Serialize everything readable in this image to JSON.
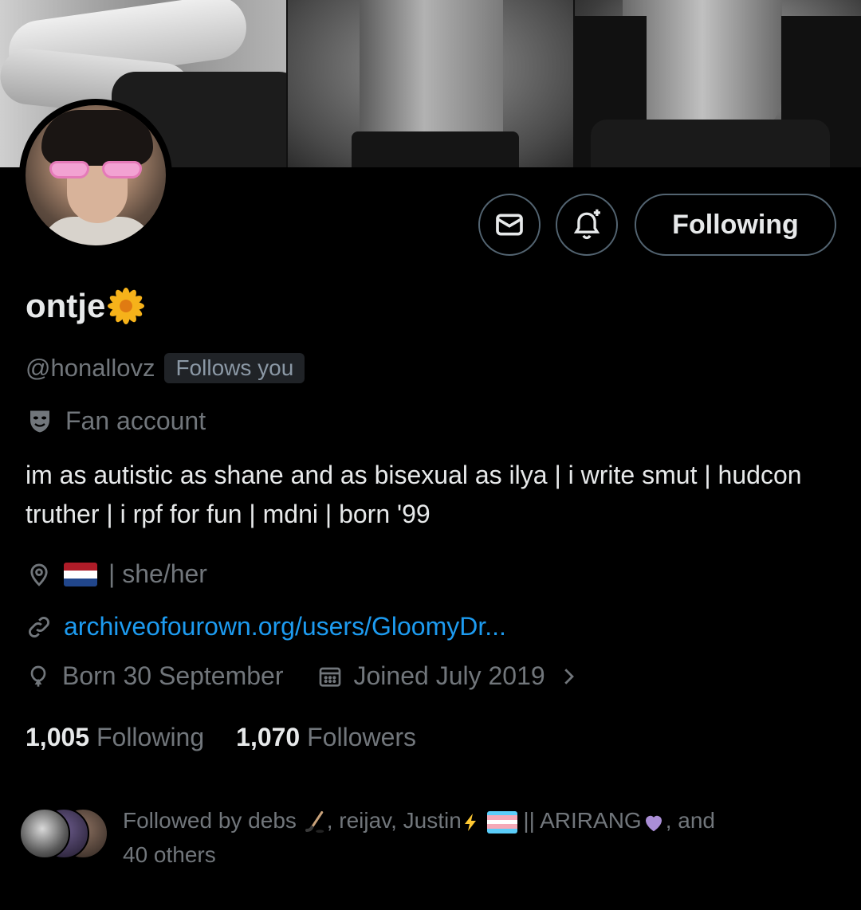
{
  "profile": {
    "display_name": "ontje",
    "name_emoji_icon": "blossom-icon",
    "handle": "@honallovz",
    "follows_you": "Follows you",
    "category": "Fan account",
    "bio": "im as autistic as shane and as bisexual as ilya | i write smut | hudcon truther | i rpf for fun | mdni | born '99",
    "location": "| she/her",
    "website": "archiveofourown.org/users/GloomyDr...",
    "birthday": "Born 30 September",
    "joined": "Joined July 2019"
  },
  "actions": {
    "following_label": "Following",
    "message_icon": "envelope-icon",
    "notify_icon": "bell-plus-icon"
  },
  "stats": {
    "following_count": "1,005",
    "following_label": "Following",
    "followers_count": "1,070",
    "followers_label": "Followers"
  },
  "followed_by": {
    "prefix": "Followed by debs",
    "part2": ", reijav, Justin",
    "part3": "|| ARIRANG",
    "part4": ", and",
    "part5": "40 others"
  },
  "colors": {
    "background": "#000000",
    "text_primary": "#e7e9ea",
    "text_secondary": "#71767b",
    "link": "#1d9bf0",
    "border": "#536471"
  }
}
